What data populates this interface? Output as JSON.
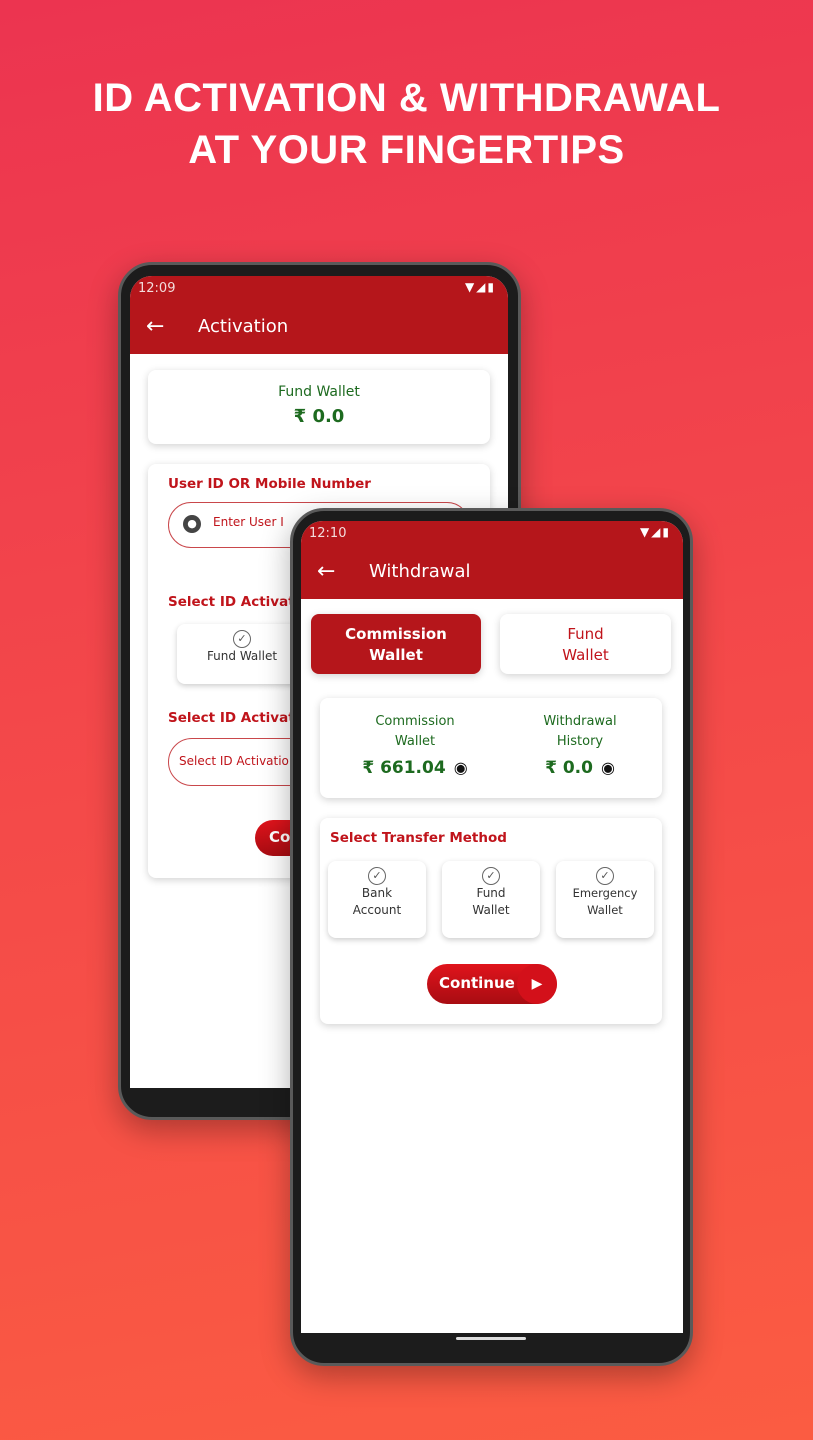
{
  "headline": {
    "line1": "ID ACTIVATION & WITHDRAWAL",
    "line2": "AT YOUR FINGERTIPS"
  },
  "colors": {
    "primary": "#b5161b",
    "accent_red": "#c0141b",
    "green": "#1d6a1f"
  },
  "activation": {
    "status_time": "12:09",
    "title": "Activation",
    "fund_wallet": {
      "label": "Fund Wallet",
      "value": "₹ 0.0"
    },
    "user_label": "User ID OR Mobile Number",
    "user_placeholder": "Enter User I",
    "select_label_1": "Select ID Activat",
    "option_fund_wallet": "Fund Wallet",
    "select_label_2": "Select ID Activat",
    "select_placeholder": "Select ID Activatio",
    "continue": "Co"
  },
  "withdrawal": {
    "status_time": "12:10",
    "title": "Withdrawal",
    "tabs": [
      {
        "label": "Commission Wallet",
        "active": true
      },
      {
        "label": "Fund Wallet",
        "active": false
      }
    ],
    "balances": [
      {
        "label": "Commission Wallet",
        "value": "₹ 661.04"
      },
      {
        "label": "Withdrawal History",
        "value": "₹ 0.0"
      }
    ],
    "transfer_label": "Select Transfer Method",
    "methods": [
      {
        "label": "Bank Account"
      },
      {
        "label": "Fund Wallet"
      },
      {
        "label": "Emergency Wallet"
      }
    ],
    "continue": "Continue"
  }
}
